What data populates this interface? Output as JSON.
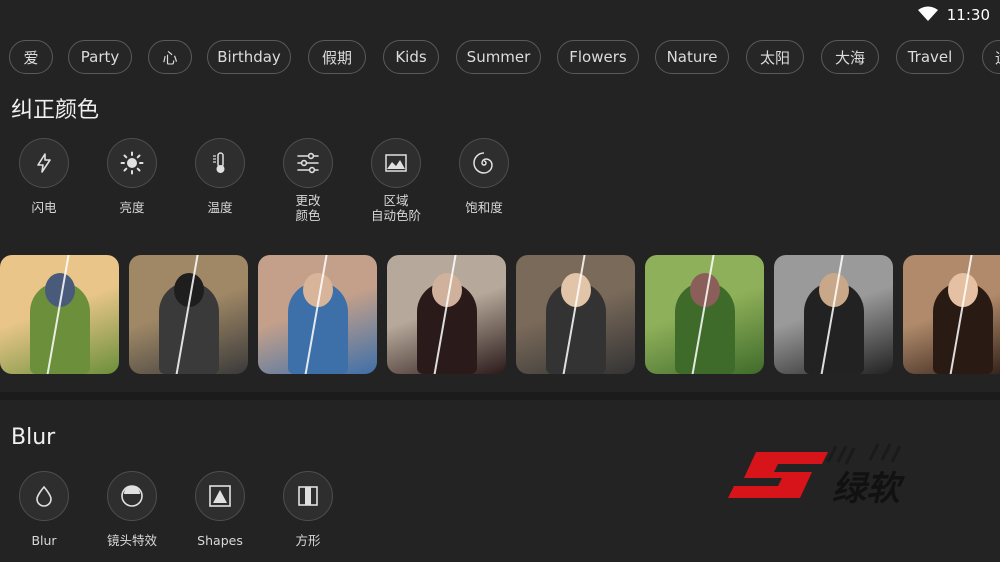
{
  "status": {
    "time": "11:30"
  },
  "tags": [
    "爱",
    "Party",
    "心",
    "Birthday",
    "假期",
    "Kids",
    "Summer",
    "Flowers",
    "Nature",
    "太阳",
    "大海",
    "Travel",
    "运"
  ],
  "sections": {
    "color": {
      "title": "纠正颜色",
      "tools": [
        {
          "label": "闪电",
          "icon": "lightning-icon"
        },
        {
          "label": "亮度",
          "icon": "brightness-icon"
        },
        {
          "label": "温度",
          "icon": "thermometer-icon"
        },
        {
          "label": "更改\n颜色",
          "icon": "sliders-icon"
        },
        {
          "label": "区域\n自动色阶",
          "icon": "landscape-icon"
        },
        {
          "label": "饱和度",
          "icon": "spiral-icon"
        }
      ]
    },
    "blur": {
      "title": "Blur",
      "tools": [
        {
          "label": "Blur",
          "icon": "drop-icon"
        },
        {
          "label": "镜头特效",
          "icon": "lens-icon"
        },
        {
          "label": "Shapes",
          "icon": "triangle-icon"
        },
        {
          "label": "方形",
          "icon": "square-split-icon"
        }
      ]
    }
  },
  "photos": [
    {
      "name": "woman-in-field",
      "colors": [
        "#e9c58a",
        "#6b8f3b",
        "#4a5a7a"
      ]
    },
    {
      "name": "girl-jumping-puddle",
      "colors": [
        "#a08866",
        "#3a3a3a",
        "#1e1e1e"
      ]
    },
    {
      "name": "couple-smiling",
      "colors": [
        "#c4a08a",
        "#3d6fa8",
        "#d8b49a"
      ]
    },
    {
      "name": "woman-brick-wall",
      "colors": [
        "#b6a89a",
        "#2b1a1a",
        "#d0b29c"
      ]
    },
    {
      "name": "woman-black-hat",
      "colors": [
        "#7a6a5a",
        "#333333",
        "#e2c4a8"
      ]
    },
    {
      "name": "park-trees",
      "colors": [
        "#8fb05a",
        "#3f6b2a",
        "#8a5f5a"
      ]
    },
    {
      "name": "two-men-sunglasses",
      "colors": [
        "#9a9a9a",
        "#222222",
        "#c9a88a"
      ]
    },
    {
      "name": "woman-headphones",
      "colors": [
        "#b08a6a",
        "#2a1a14",
        "#e6c0a2"
      ]
    }
  ],
  "watermark": {
    "text": "绿软"
  },
  "colors": {
    "accent": "#d8141b",
    "background": "#232323",
    "chip_border": "#5a5a5a"
  }
}
